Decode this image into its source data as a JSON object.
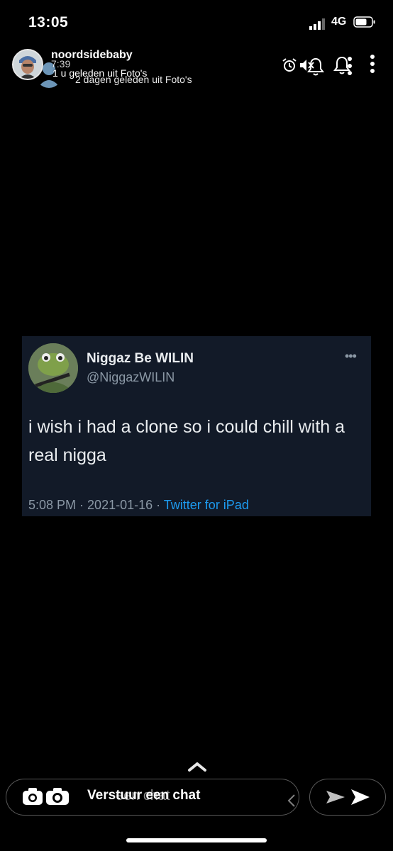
{
  "status_bar": {
    "time": "13:05",
    "network": "4G",
    "icons": [
      "signal-icon",
      "battery-icon"
    ]
  },
  "story_header": {
    "username": "noordsidebaby",
    "ghost_username": "7:39",
    "subtitle_primary": "1 u geleden uit Foto's",
    "subtitle_secondary": "2 dagen geleden uit Foto's",
    "icons": [
      "alarm-icon",
      "mute-icon",
      "bell-icon",
      "more-vertical-icon"
    ]
  },
  "tweet": {
    "display_name": "Niggaz Be WILIN",
    "handle": "@NiggazWILIN",
    "text": "i wish i had a clone so i could chill with a real nigga",
    "time": "5:08 PM",
    "separator": " · ",
    "date": "2021-01-16",
    "source": "Twitter for iPad",
    "more_label": "•••",
    "background": "#121a28",
    "link_color": "#1d9bf0"
  },
  "bottom_bar": {
    "chat_placeholder": "Verstuur een chat",
    "chat_placeholder_ghost": "een chat",
    "icons": [
      "camera-icon",
      "chevron-up-icon",
      "send-icon"
    ]
  }
}
